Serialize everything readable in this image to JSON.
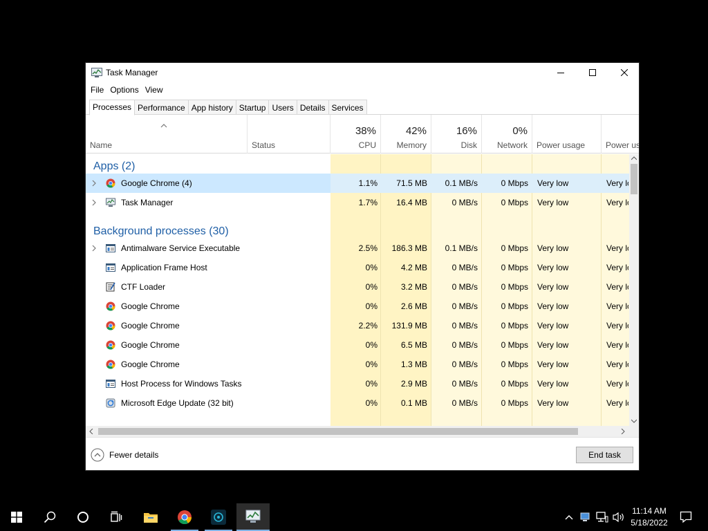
{
  "window": {
    "title": "Task Manager",
    "menu": [
      "File",
      "Options",
      "View"
    ],
    "tabs": [
      "Processes",
      "Performance",
      "App history",
      "Startup",
      "Users",
      "Details",
      "Services"
    ],
    "active_tab": "Processes"
  },
  "columns": {
    "name": "Name",
    "status": "Status",
    "cpu": {
      "pct": "38%",
      "label": "CPU"
    },
    "memory": {
      "pct": "42%",
      "label": "Memory"
    },
    "disk": {
      "pct": "16%",
      "label": "Disk"
    },
    "network": {
      "pct": "0%",
      "label": "Network"
    },
    "power": "Power usage",
    "power_trend": "Power us"
  },
  "groups": {
    "apps": "Apps (2)",
    "background": "Background processes (30)"
  },
  "apps": [
    {
      "name": "Google Chrome (4)",
      "icon": "chrome-icon",
      "expandable": true,
      "selected": true,
      "cpu": "1.1%",
      "mem": "71.5 MB",
      "disk": "0.1 MB/s",
      "net": "0 Mbps",
      "power": "Very low",
      "power_trend": "Very lo"
    },
    {
      "name": "Task Manager",
      "icon": "task-manager-icon",
      "expandable": true,
      "selected": false,
      "cpu": "1.7%",
      "mem": "16.4 MB",
      "disk": "0 MB/s",
      "net": "0 Mbps",
      "power": "Very low",
      "power_trend": "Very lo"
    }
  ],
  "background": [
    {
      "name": "Antimalware Service Executable",
      "icon": "service-icon",
      "expandable": true,
      "cpu": "2.5%",
      "mem": "186.3 MB",
      "disk": "0.1 MB/s",
      "net": "0 Mbps",
      "power": "Very low",
      "power_trend": "Very lo"
    },
    {
      "name": "Application Frame Host",
      "icon": "service-icon",
      "expandable": false,
      "cpu": "0%",
      "mem": "4.2 MB",
      "disk": "0 MB/s",
      "net": "0 Mbps",
      "power": "Very low",
      "power_trend": "Very lo"
    },
    {
      "name": "CTF Loader",
      "icon": "ctf-loader-icon",
      "expandable": false,
      "cpu": "0%",
      "mem": "3.2 MB",
      "disk": "0 MB/s",
      "net": "0 Mbps",
      "power": "Very low",
      "power_trend": "Very lo"
    },
    {
      "name": "Google Chrome",
      "icon": "chrome-icon",
      "expandable": false,
      "cpu": "0%",
      "mem": "2.6 MB",
      "disk": "0 MB/s",
      "net": "0 Mbps",
      "power": "Very low",
      "power_trend": "Very lo"
    },
    {
      "name": "Google Chrome",
      "icon": "chrome-icon",
      "expandable": false,
      "cpu": "2.2%",
      "mem": "131.9 MB",
      "disk": "0 MB/s",
      "net": "0 Mbps",
      "power": "Very low",
      "power_trend": "Very lo"
    },
    {
      "name": "Google Chrome",
      "icon": "chrome-icon",
      "expandable": false,
      "cpu": "0%",
      "mem": "6.5 MB",
      "disk": "0 MB/s",
      "net": "0 Mbps",
      "power": "Very low",
      "power_trend": "Very lo"
    },
    {
      "name": "Google Chrome",
      "icon": "chrome-icon",
      "expandable": false,
      "cpu": "0%",
      "mem": "1.3 MB",
      "disk": "0 MB/s",
      "net": "0 Mbps",
      "power": "Very low",
      "power_trend": "Very lo"
    },
    {
      "name": "Host Process for Windows Tasks",
      "icon": "service-icon",
      "expandable": false,
      "cpu": "0%",
      "mem": "2.9 MB",
      "disk": "0 MB/s",
      "net": "0 Mbps",
      "power": "Very low",
      "power_trend": "Very lo"
    },
    {
      "name": "Microsoft Edge Update (32 bit)",
      "icon": "edge-update-icon",
      "expandable": false,
      "cpu": "0%",
      "mem": "0.1 MB",
      "disk": "0 MB/s",
      "net": "0 Mbps",
      "power": "Very low",
      "power_trend": "Very lo"
    }
  ],
  "footer": {
    "fewer_details": "Fewer details",
    "end_task": "End task"
  },
  "taskbar": {
    "items": [
      "start-icon",
      "search-icon",
      "cortana-icon",
      "task-view-icon",
      "file-explorer-icon",
      "chrome-icon",
      "app-icon",
      "task-manager-icon"
    ],
    "time": "11:14 AM",
    "date": "5/18/2022"
  },
  "colors": {
    "heat_strong": "#fff4c4",
    "heat_light": "#fff9dc",
    "selection": "#cce8ff",
    "group_text": "#1f5fa6",
    "taskbar_accent": "#7fb2e5"
  }
}
